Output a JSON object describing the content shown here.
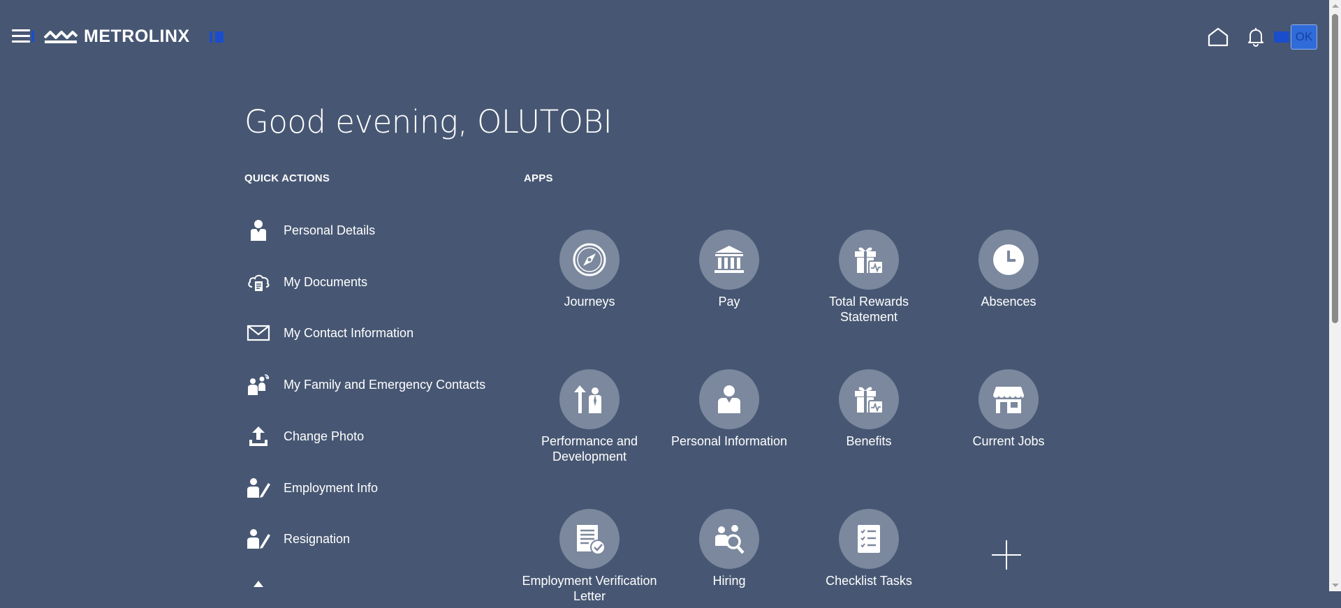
{
  "header": {
    "logo_text": "METROLINX",
    "user_button_label": "OK"
  },
  "icons": {
    "menu": "hamburger-menu-icon",
    "home": "home-icon",
    "notifications": "bell-icon"
  },
  "greeting": "Good evening, OLUTOBI",
  "quick_actions": {
    "heading": "QUICK ACTIONS",
    "items": [
      {
        "label": "Personal Details",
        "icon": "person-icon"
      },
      {
        "label": "My Documents",
        "icon": "cloud-document-icon"
      },
      {
        "label": "My Contact Information",
        "icon": "envelope-icon"
      },
      {
        "label": "My Family and Emergency Contacts",
        "icon": "family-icon"
      },
      {
        "label": "Change Photo",
        "icon": "upload-icon"
      },
      {
        "label": "Employment Info",
        "icon": "person-edit-icon"
      },
      {
        "label": "Resignation",
        "icon": "person-edit-icon"
      }
    ]
  },
  "apps": {
    "heading": "APPS",
    "items": [
      {
        "label": "Journeys",
        "icon": "compass-icon"
      },
      {
        "label": "Pay",
        "icon": "bank-icon"
      },
      {
        "label": "Total Rewards Statement",
        "icon": "gift-chart-icon"
      },
      {
        "label": "Absences",
        "icon": "clock-icon"
      },
      {
        "label": "Performance and Development",
        "icon": "growth-person-icon"
      },
      {
        "label": "Personal Information",
        "icon": "person-icon"
      },
      {
        "label": "Benefits",
        "icon": "gift-chart-icon"
      },
      {
        "label": "Current Jobs",
        "icon": "storefront-icon"
      },
      {
        "label": "Employment Verification Letter",
        "icon": "document-check-icon"
      },
      {
        "label": "Hiring",
        "icon": "people-search-icon"
      },
      {
        "label": "Checklist Tasks",
        "icon": "checklist-icon"
      }
    ],
    "add_icon": "plus-icon"
  },
  "colors": {
    "background": "#475773",
    "app_circle": "#7b889d",
    "accent": "#1a4dcc"
  }
}
